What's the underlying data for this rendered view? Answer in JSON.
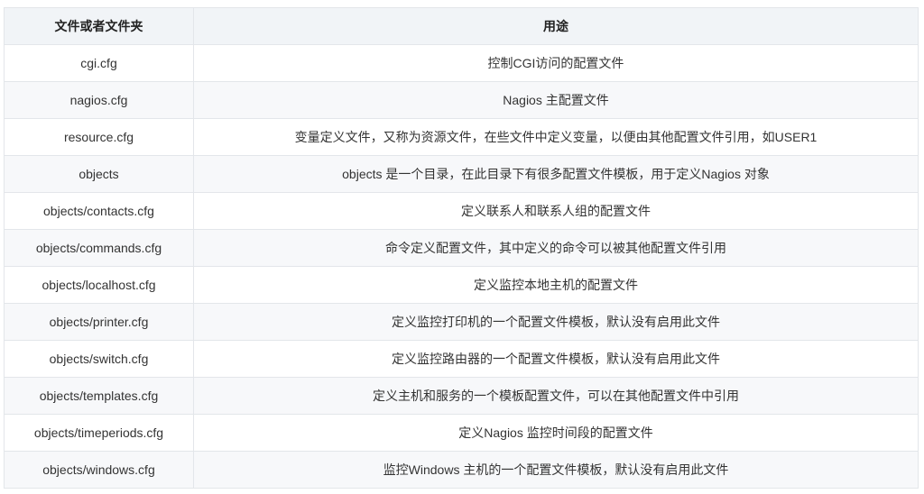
{
  "table": {
    "headers": {
      "file": "文件或者文件夹",
      "use": "用途"
    },
    "rows": [
      {
        "file": "cgi.cfg",
        "use": "控制CGI访问的配置文件"
      },
      {
        "file": "nagios.cfg",
        "use": "Nagios 主配置文件"
      },
      {
        "file": "resource.cfg",
        "use": "变量定义文件，又称为资源文件，在些文件中定义变量，以便由其他配置文件引用，如USER1"
      },
      {
        "file": "objects",
        "use": "objects 是一个目录，在此目录下有很多配置文件模板，用于定义Nagios 对象"
      },
      {
        "file": "objects/contacts.cfg",
        "use": "定义联系人和联系人组的配置文件"
      },
      {
        "file": "objects/commands.cfg",
        "use": "命令定义配置文件，其中定义的命令可以被其他配置文件引用"
      },
      {
        "file": "objects/localhost.cfg",
        "use": "定义监控本地主机的配置文件"
      },
      {
        "file": "objects/printer.cfg",
        "use": "定义监控打印机的一个配置文件模板，默认没有启用此文件"
      },
      {
        "file": "objects/switch.cfg",
        "use": "定义监控路由器的一个配置文件模板，默认没有启用此文件"
      },
      {
        "file": "objects/templates.cfg",
        "use": "定义主机和服务的一个模板配置文件，可以在其他配置文件中引用"
      },
      {
        "file": "objects/timeperiods.cfg",
        "use": "定义Nagios 监控时间段的配置文件"
      },
      {
        "file": "objects/windows.cfg",
        "use": "监控Windows 主机的一个配置文件模板，默认没有启用此文件"
      }
    ]
  }
}
